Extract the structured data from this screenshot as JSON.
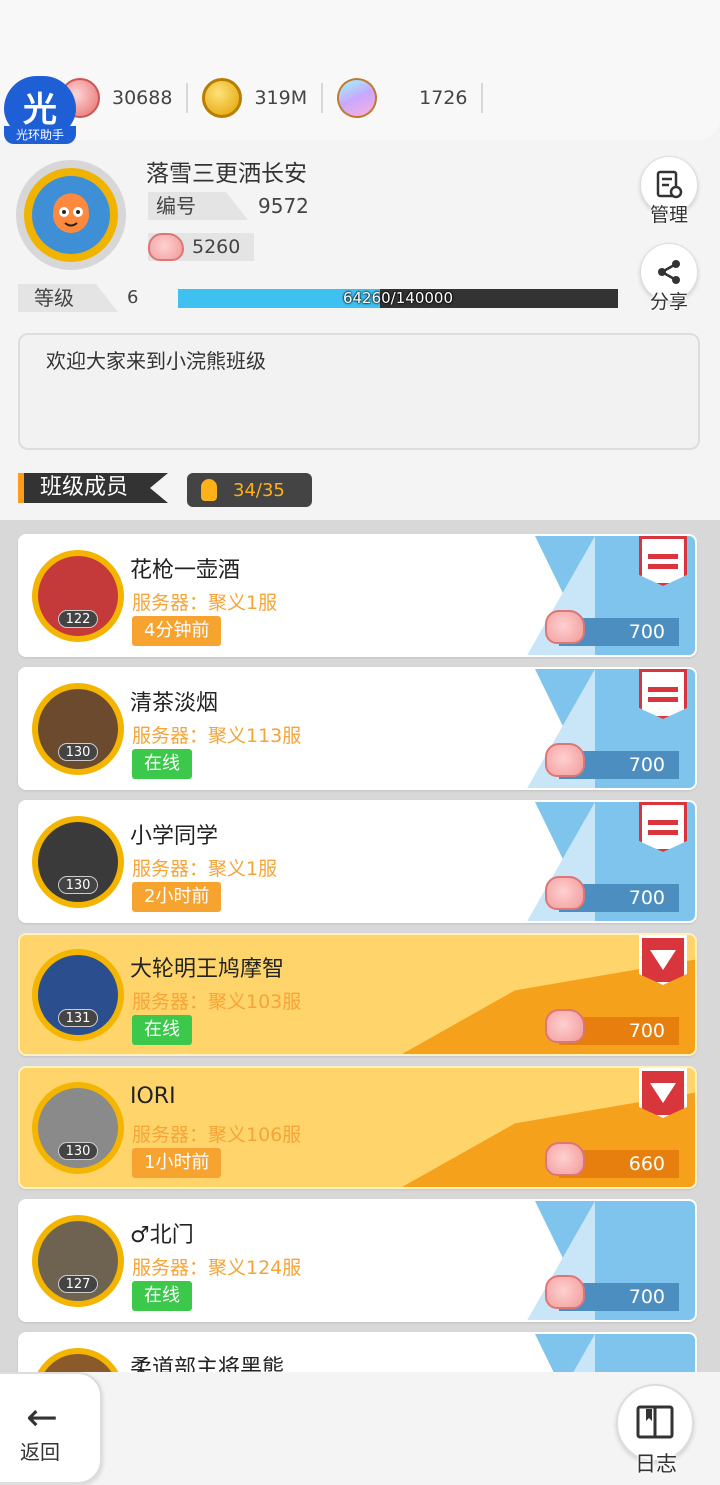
{
  "resources": [
    {
      "icon": "gem-icon",
      "value": "30688"
    },
    {
      "icon": "gold-coin-icon",
      "value": "319M"
    },
    {
      "icon": "crystal-icon",
      "value": "1726"
    }
  ],
  "helper": {
    "glyph": "光",
    "label": "光环助手"
  },
  "profile": {
    "name": "落雪三更洒长安",
    "id_label": "编号",
    "id_value": "9572",
    "piggy_value": "5260",
    "level_label": "等级",
    "level_value": "6",
    "xp_text": "64260/140000",
    "xp_current": 64260,
    "xp_max": 140000
  },
  "actions": {
    "manage_label": "管理",
    "share_label": "分享"
  },
  "announcement": "欢迎大家来到小浣熊班级",
  "members_section": {
    "title": "班级成员",
    "count": "34/35"
  },
  "members": [
    {
      "name": "花枪一壶酒",
      "level": "122",
      "server": "服务器：聚义1服",
      "status": "4分钟前",
      "status_type": "time",
      "points": "700",
      "badge": "rank-badge",
      "gold": false
    },
    {
      "name": "清茶淡烟",
      "level": "130",
      "server": "服务器：聚义113服",
      "status": "在线",
      "status_type": "online",
      "points": "700",
      "badge": "rank-badge",
      "gold": false
    },
    {
      "name": "小学同学",
      "level": "130",
      "server": "服务器：聚义1服",
      "status": "2小时前",
      "status_type": "time",
      "points": "700",
      "badge": "rank-badge",
      "gold": false
    },
    {
      "name": "大轮明王鸠摩智",
      "level": "131",
      "server": "服务器：聚义103服",
      "status": "在线",
      "status_type": "online",
      "points": "700",
      "badge": "vice-badge",
      "gold": true
    },
    {
      "name": "IORI",
      "level": "130",
      "server": "服务器：聚义106服",
      "status": "1小时前",
      "status_type": "time",
      "points": "660",
      "badge": "vice-badge",
      "gold": true
    },
    {
      "name": "♂北门",
      "level": "127",
      "server": "服务器：聚义124服",
      "status": "在线",
      "status_type": "online",
      "points": "700",
      "badge": "none",
      "gold": false
    },
    {
      "name": "柔道部主将黑熊",
      "level": "",
      "server": "",
      "status": "",
      "status_type": "none",
      "points": "",
      "badge": "none",
      "gold": false
    }
  ],
  "bottom": {
    "back_label": "返回",
    "log_label": "日志"
  },
  "colors": {
    "accent": "#ff9b1a",
    "online": "#3cc84b",
    "time": "#f6a330",
    "server_text": "#f6a438",
    "xp": "#3ec0f0"
  }
}
